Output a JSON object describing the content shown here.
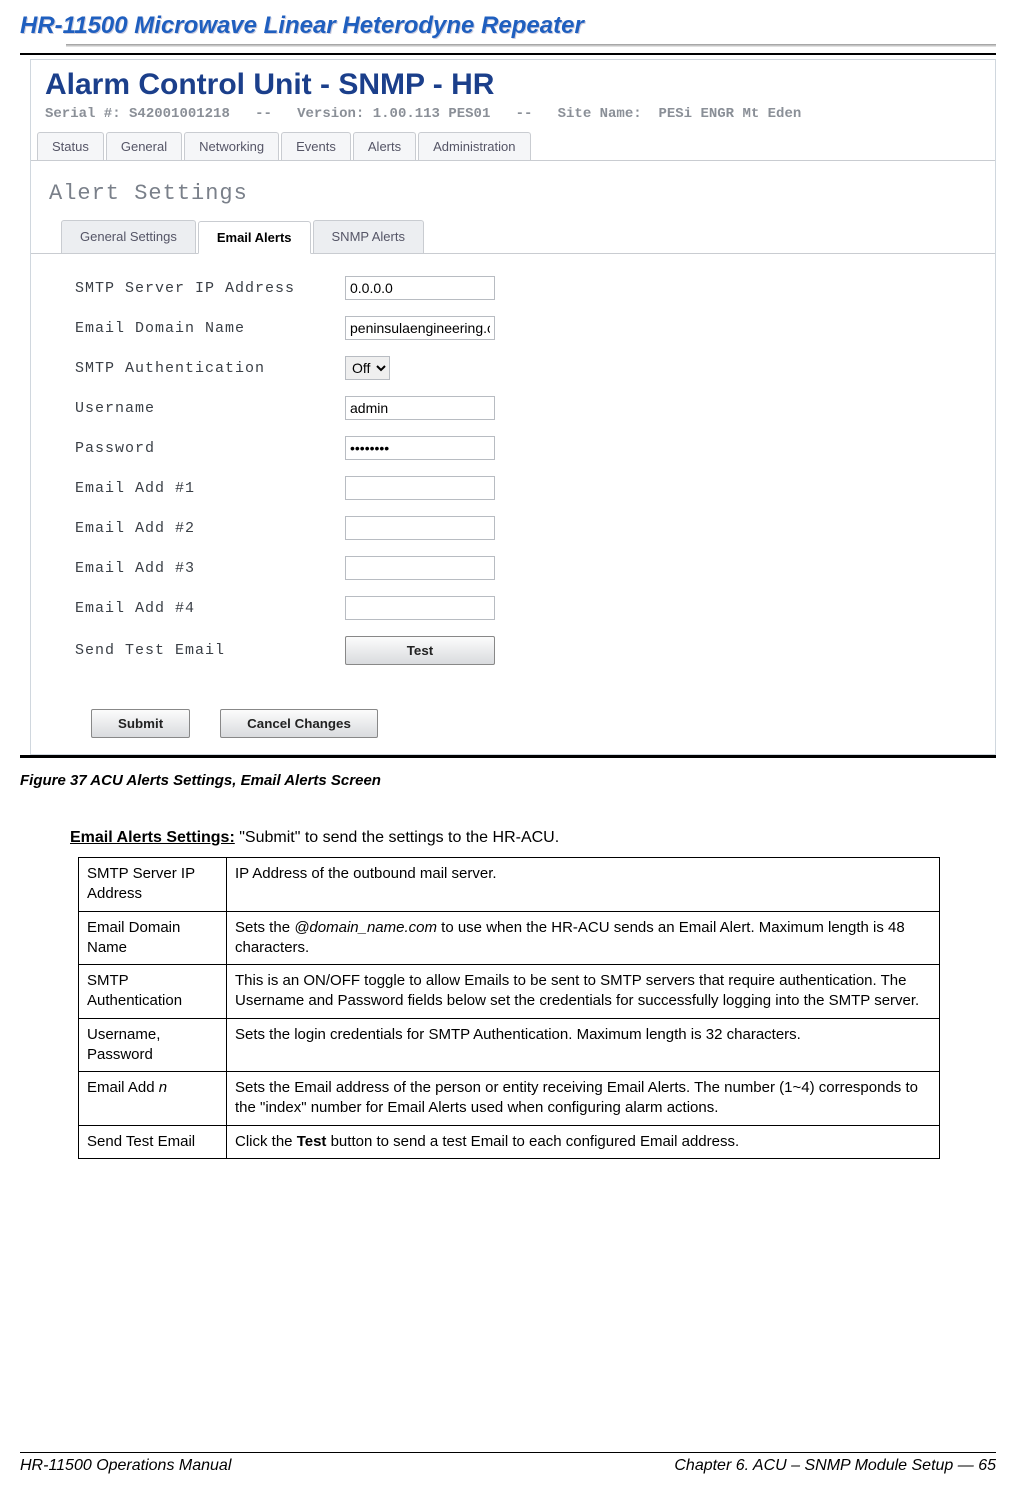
{
  "document": {
    "title": "HR-11500 Microwave Linear Heterodyne Repeater",
    "figure_caption": "Figure 37  ACU Alerts Settings, Email Alerts Screen",
    "footer_left": "HR-11500 Operations Manual",
    "footer_right": "Chapter 6. ACU – SNMP Module Setup — 65"
  },
  "acu": {
    "header_title": "Alarm Control Unit - SNMP - HR",
    "meta_serial_label": "Serial #:",
    "meta_serial": "S42001001218",
    "meta_sep": "--",
    "meta_version_label": "Version:",
    "meta_version": "1.00.113 PES01",
    "meta_site_label": "Site Name:",
    "meta_site": "PESi ENGR Mt Eden",
    "tabs": [
      "Status",
      "General",
      "Networking",
      "Events",
      "Alerts",
      "Administration"
    ],
    "section_title": "Alert Settings",
    "subtabs": [
      "General Settings",
      "Email Alerts",
      "SNMP Alerts"
    ],
    "form": {
      "smtp_ip_label": "SMTP Server IP Address",
      "smtp_ip_value": "0.0.0.0",
      "domain_label": "Email Domain Name",
      "domain_value": "peninsulaengineering.c",
      "smtp_auth_label": "SMTP Authentication",
      "smtp_auth_value": "Off",
      "username_label": "Username",
      "username_value": "admin",
      "password_label": "Password",
      "password_value": "••••••••",
      "email1_label": "Email Add #1",
      "email1_value": "",
      "email2_label": "Email Add #2",
      "email2_value": "",
      "email3_label": "Email Add #3",
      "email3_value": "",
      "email4_label": "Email Add #4",
      "email4_value": "",
      "send_test_label": "Send Test Email",
      "test_button": "Test",
      "submit_button": "Submit",
      "cancel_button": "Cancel Changes"
    }
  },
  "settings_section": {
    "lead": "Email Alerts Settings:",
    "intro_rest": " \"Submit\" to send the settings to the HR-ACU.",
    "rows": [
      {
        "name": "SMTP Server IP Address",
        "desc": "IP Address of the outbound mail server."
      },
      {
        "name": "Email Domain Name",
        "desc_pre": "Sets the ",
        "desc_em": "@domain_name.com",
        "desc_post": " to use when the HR-ACU sends an Email Alert. Maximum length is 48 characters."
      },
      {
        "name": "SMTP Authentication",
        "desc": "This is an ON/OFF toggle to allow Emails to be sent to SMTP servers that require authentication. The Username and Password fields below set the credentials for successfully logging into the SMTP server."
      },
      {
        "name": "Username, Password",
        "desc": "Sets the login credentials for SMTP Authentication. Maximum length is 32 characters."
      },
      {
        "name_pre": "Email Add ",
        "name_em": "n",
        "desc": "Sets the Email address of the person or entity receiving Email Alerts. The number (1~4) corresponds to the \"index\" number for Email Alerts used when configuring alarm actions."
      },
      {
        "name": "Send Test Email",
        "desc_pre": "Click the ",
        "desc_strong": "Test",
        "desc_post": " button to send a test Email to each configured Email address."
      }
    ]
  }
}
